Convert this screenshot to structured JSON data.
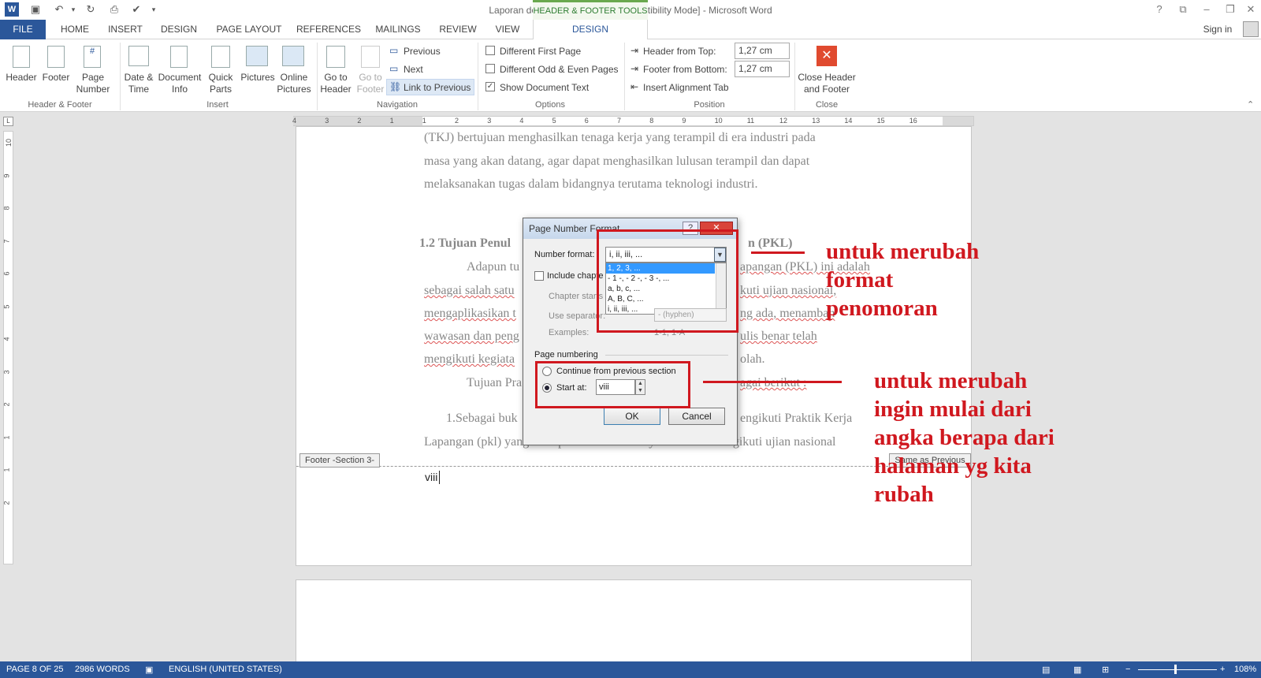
{
  "window": {
    "title": "Laporan detia (Repaired).doc [Compatibility Mode] - Microsoft Word",
    "context_tab_group": "HEADER & FOOTER TOOLS",
    "sign_in": "Sign in",
    "help": "?"
  },
  "tabs": [
    "FILE",
    "HOME",
    "INSERT",
    "DESIGN",
    "PAGE LAYOUT",
    "REFERENCES",
    "MAILINGS",
    "REVIEW",
    "VIEW",
    "DESIGN"
  ],
  "ribbon": {
    "header": "Header",
    "footer": "Footer",
    "page_number": "Page\nNumber",
    "date_time": "Date &\nTime",
    "document_info": "Document\nInfo",
    "quick_parts": "Quick\nParts",
    "pictures": "Pictures",
    "online_pictures": "Online\nPictures",
    "go_to_header": "Go to\nHeader",
    "go_to_footer": "Go to\nFooter",
    "previous": "Previous",
    "next": "Next",
    "link_to_previous": "Link to Previous",
    "different_first_page": "Different First Page",
    "different_odd_even": "Different Odd & Even Pages",
    "show_document_text": "Show Document Text",
    "header_from_top_label": "Header from Top:",
    "header_from_top_value": "1,27 cm",
    "footer_from_bottom_label": "Footer from Bottom:",
    "footer_from_bottom_value": "1,27 cm",
    "insert_alignment_tab": "Insert Alignment Tab",
    "close_header_footer": "Close Header\nand Footer",
    "groups": {
      "header_footer": "Header & Footer",
      "insert": "Insert",
      "navigation": "Navigation",
      "options": "Options",
      "position": "Position",
      "close": "Close"
    }
  },
  "document": {
    "lines": [
      "(TKJ) bertujuan menghasilkan tenaga kerja yang terampil di era industri pada",
      "masa yang akan datang, agar dapat menghasilkan lulusan terampil dan dapat",
      "melaksanakan tugas dalam bidangnya terutama teknologi industri."
    ],
    "heading_left": "1.2 Tujuan Penul",
    "heading_right": "n (PKL)",
    "p1_left": "Adapun tu",
    "p1_right": "apangan (PKL) ini adalah",
    "p2_left": "sebagai salah satu",
    "p2_right": "kuti ujian nasional,",
    "p3_left": "mengaplikasikan t",
    "p3_right": "ng ada, menambah",
    "p4_left": "wawasan dan peng",
    "p4_right": "ulis benar telah",
    "p5_left": "mengikuti kegiata",
    "p5_right": "olah.",
    "p6_left": "Tujuan Pra",
    "p6_right": "agai berikut :",
    "p7_left": "1.Sebagai buk",
    "p7_right": "engikuti Praktik Kerja",
    "p8": "Lapangan (pkl) yang merupakan salah satu syarat dalam mengikuti ujian nasional",
    "footer_tag": "Footer -Section 3-",
    "same_as_previous": "Same as Previous",
    "footer_page_number": "viii"
  },
  "dialog": {
    "title": "Page Number Format",
    "help": "?",
    "close": "✕",
    "number_format_label": "Number format:",
    "number_format_value": "i, ii, iii, ...",
    "format_options": [
      "1, 2, 3, ...",
      "- 1 -, - 2 -, - 3 -, ...",
      "a, b, c, ...",
      "A, B, C, ...",
      "i, ii, iii, ..."
    ],
    "include_chapter": "Include chapter",
    "chapter_starts": "Chapter starts",
    "use_separator": "Use separator:",
    "separator_value": "-  (hyphen)",
    "examples_label": "Examples:",
    "examples_value": "1-1, 1-A",
    "page_numbering": "Page numbering",
    "continue_prev": "Continue from previous section",
    "start_at": "Start at:",
    "start_at_value": "viii",
    "ok": "OK",
    "cancel": "Cancel"
  },
  "annotations": {
    "format_note": "untuk merubah\nformat\npenomoran",
    "start_note": "untuk merubah\ningin mulai dari\nangka berapa dari\nhalaman yg kita\nrubah"
  },
  "status": {
    "page": "PAGE 8 OF 25",
    "words": "2986 WORDS",
    "language": "ENGLISH (UNITED STATES)",
    "zoom": "108%"
  },
  "ruler_h": [
    "4",
    "3",
    "2",
    "1",
    "1",
    "2",
    "3",
    "4",
    "5",
    "6",
    "7",
    "8",
    "9",
    "10",
    "11",
    "12",
    "13",
    "14",
    "15",
    "16"
  ],
  "ruler_v": [
    "10",
    "9",
    "8",
    "7",
    "6",
    "5",
    "4",
    "3",
    "2",
    "1",
    "1",
    "2"
  ],
  "colors": {
    "accent": "#2b579a",
    "annotation": "#d0181f",
    "context_green": "#6aa84f"
  }
}
